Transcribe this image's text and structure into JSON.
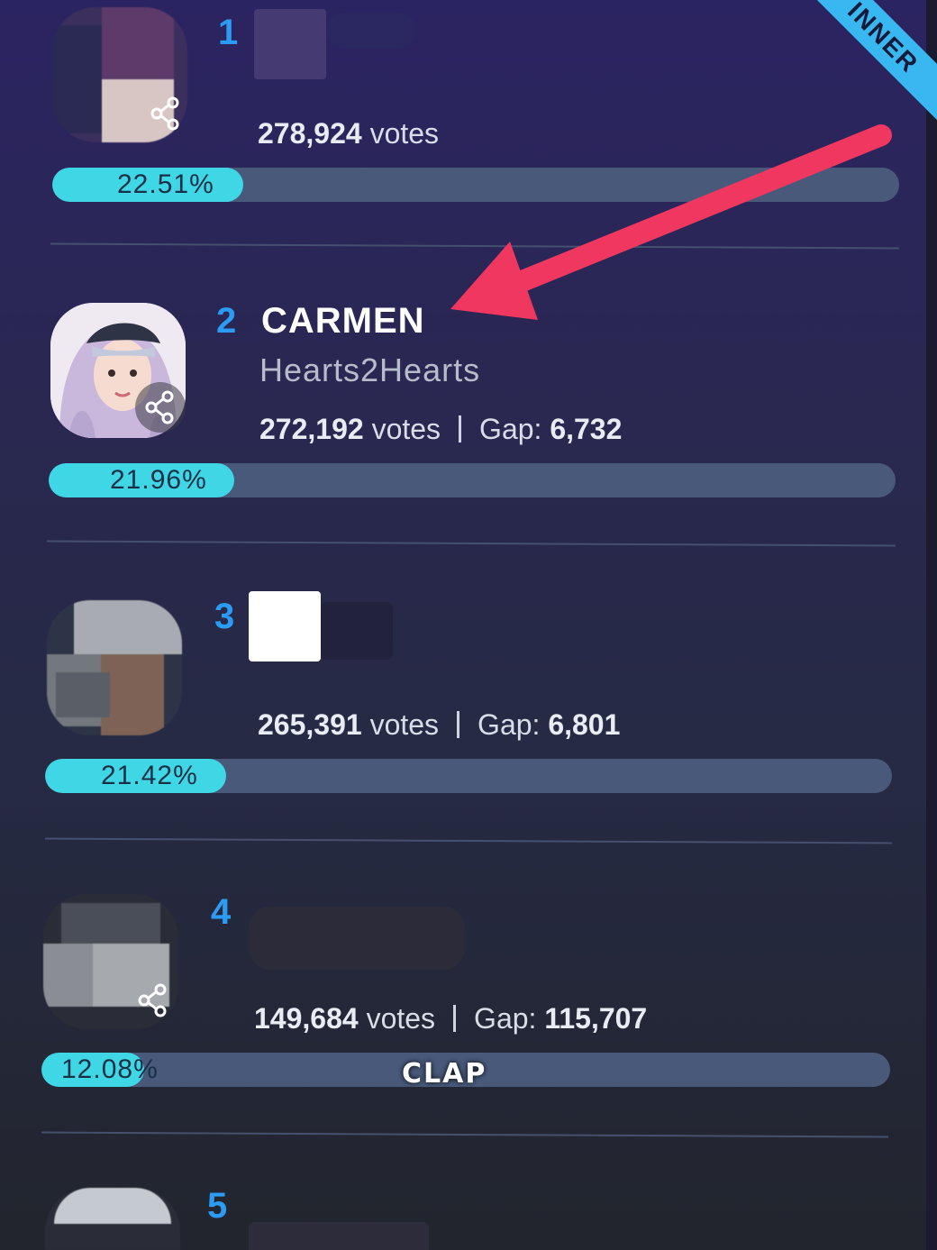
{
  "ribbon": {
    "label": "INNER"
  },
  "entries": [
    {
      "rank": "1",
      "name": "",
      "group": "",
      "votes": "278,924",
      "votes_unit": "votes",
      "gap_label": "",
      "gap": "",
      "percent_label": "22.51%",
      "percent": 22.51
    },
    {
      "rank": "2",
      "name": "CARMEN",
      "group": "Hearts2Hearts",
      "votes": "272,192",
      "votes_unit": "votes",
      "gap_label": "Gap:",
      "gap": "6,732",
      "percent_label": "21.96%",
      "percent": 21.96
    },
    {
      "rank": "3",
      "name": "",
      "group": "",
      "votes": "265,391",
      "votes_unit": "votes",
      "gap_label": "Gap:",
      "gap": "6,801",
      "percent_label": "21.42%",
      "percent": 21.42
    },
    {
      "rank": "4",
      "name": "",
      "group": "",
      "votes": "149,684",
      "votes_unit": "votes",
      "gap_label": "Gap:",
      "gap": "115,707",
      "percent_label": "12.08%",
      "percent": 12.08
    },
    {
      "rank": "5"
    }
  ],
  "overlay": {
    "clap_label": "CLAP"
  },
  "colors": {
    "accent_rank": "#2c9bf3",
    "bar_fill": "#3fd7e6",
    "bar_track": "#48597a",
    "arrow": "#f0375f",
    "ribbon": "#39b7f0"
  },
  "icons": [
    "share-icon",
    "arrow-annotation"
  ]
}
